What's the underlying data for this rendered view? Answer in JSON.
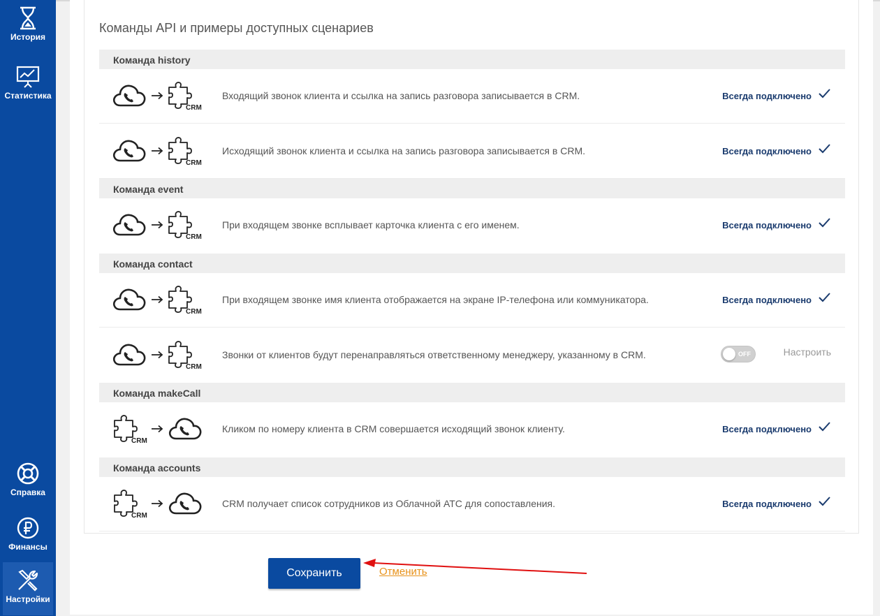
{
  "sidebar": {
    "history": "История",
    "stats": "Статистика",
    "help": "Справка",
    "finance": "Финансы",
    "settings": "Настройки"
  },
  "panel": {
    "title": "Команды API и примеры доступных сценариев"
  },
  "sections": {
    "history": "Команда history",
    "event": "Команда event",
    "contact": "Команда contact",
    "makecall": "Команда makeCall",
    "accounts": "Команда accounts"
  },
  "rows": {
    "r1": {
      "desc": "Входящий звонок клиента и ссылка на запись разговора записывается в CRM.",
      "status": "Всегда подключено"
    },
    "r2": {
      "desc": "Исходящий звонок клиента и ссылка на запись разговора записывается в CRM.",
      "status": "Всегда подключено"
    },
    "r3": {
      "desc": "При входящем звонке всплывает карточка клиента с его именем.",
      "status": "Всегда подключено"
    },
    "r4": {
      "desc": "При входящем звонке имя клиента отображается на экране IP-телефона или коммуникатора.",
      "status": "Всегда подключено"
    },
    "r5": {
      "desc": "Звонки от клиентов будут перенаправляться ответственному менеджеру, указанному в CRM.",
      "toggle": "OFF",
      "configure": "Настроить"
    },
    "r6": {
      "desc": "Кликом по номеру клиента в CRM совершается исходящий звонок клиенту.",
      "status": "Всегда подключено"
    },
    "r7": {
      "desc": "CRM получает список сотрудников из Облачной АТС для сопоставления.",
      "status": "Всегда подключено"
    }
  },
  "crm_label": "CRM",
  "actions": {
    "save": "Сохранить",
    "cancel": "Отменить"
  },
  "colors": {
    "sidebar": "#0a4aa0",
    "status": "#1a3b6e",
    "cancel": "#e8921a",
    "annotation_arrow": "#e01010"
  }
}
